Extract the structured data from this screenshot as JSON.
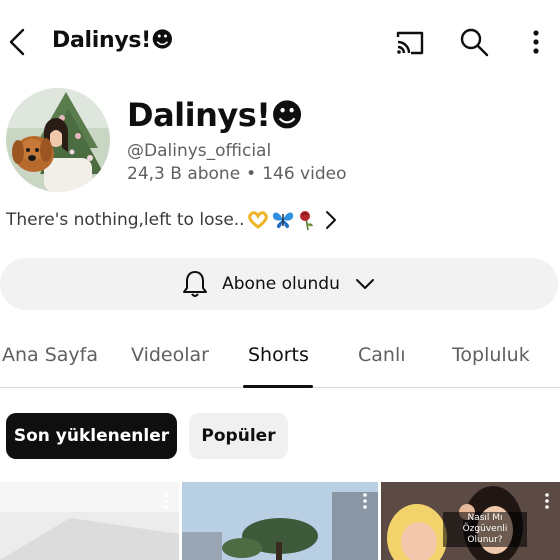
{
  "header": {
    "title": "Dalinys!☻"
  },
  "channel": {
    "name": "Dalinys!☻",
    "handle": "@Dalinys_official",
    "subscribers": "24,3 B abone",
    "separator": "•",
    "videos": "146 video",
    "description": "There's nothing,left to lose.."
  },
  "subscribe": {
    "label": "Abone olundu"
  },
  "tabs": [
    {
      "label": "Ana Sayfa"
    },
    {
      "label": "Videolar"
    },
    {
      "label": "Shorts"
    },
    {
      "label": "Canlı"
    },
    {
      "label": "Topluluk"
    }
  ],
  "active_tab": "Shorts",
  "filters": [
    {
      "label": "Son yüklenenler"
    },
    {
      "label": "Popüler"
    }
  ],
  "shorts": [
    {
      "caption": ""
    },
    {
      "caption": ""
    },
    {
      "caption": "Nasıl Mı Özgüvenli Olunur?"
    }
  ],
  "icons": {
    "back": "back-arrow-icon",
    "cast": "cast-icon",
    "search": "search-icon",
    "more": "more-vert-icon",
    "bell": "bell-icon",
    "dropdown": "chevron-down-icon",
    "expand": "chevron-right-icon"
  },
  "colors": {
    "text": "#0f0f0f",
    "secondary": "#606060",
    "chip_active": "#0f0f0f",
    "chip_idle": "#f0f0f0",
    "subscribe_bg": "#f2f2f2"
  }
}
